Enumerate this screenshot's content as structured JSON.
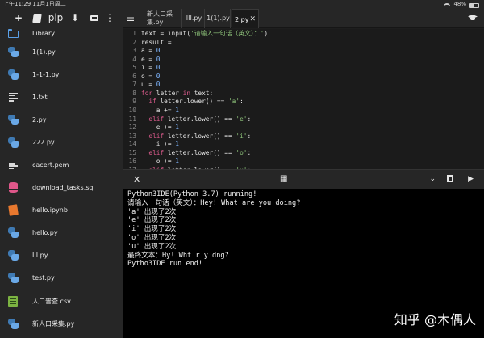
{
  "status_bar": {
    "time": "上午11:29",
    "date": "11月1日周二",
    "battery": "48%",
    "battery_level": 0.48
  },
  "sidebar": {
    "toolbar": {
      "add_label": "+",
      "pip_label": "pip",
      "download_label": "⬇",
      "more_label": "⋮"
    },
    "files": [
      {
        "name": "Library",
        "icon": "folder-icon"
      },
      {
        "name": "1(1).py",
        "icon": "python-file-icon"
      },
      {
        "name": "1-1-1.py",
        "icon": "python-file-icon"
      },
      {
        "name": "1.txt",
        "icon": "text-file-icon"
      },
      {
        "name": "2.py",
        "icon": "python-file-icon"
      },
      {
        "name": "222.py",
        "icon": "python-file-icon"
      },
      {
        "name": "cacert.pem",
        "icon": "text-file-icon"
      },
      {
        "name": "download_tasks.sql",
        "icon": "database-file-icon"
      },
      {
        "name": "hello.ipynb",
        "icon": "notebook-file-icon"
      },
      {
        "name": "hello.py",
        "icon": "python-file-icon"
      },
      {
        "name": "III.py",
        "icon": "python-file-icon"
      },
      {
        "name": "test.py",
        "icon": "python-file-icon"
      },
      {
        "name": "人口普查.csv",
        "icon": "csv-file-icon"
      },
      {
        "name": "新人口采集.py",
        "icon": "python-file-icon"
      }
    ]
  },
  "tabs": [
    {
      "label_line1": "新人口采",
      "label_line2": "集.py"
    },
    {
      "label": "III.py"
    },
    {
      "label": "1(1).py"
    },
    {
      "label": "2.py",
      "active": true,
      "close": "✕"
    }
  ],
  "code": {
    "lines": [
      {
        "n": "1",
        "parts": [
          [
            "tx",
            "text = "
          ],
          [
            "fn",
            "input"
          ],
          [
            "tx",
            "("
          ],
          [
            "str",
            "'请输入一句话（英文）：'"
          ],
          [
            "tx",
            ")"
          ]
        ]
      },
      {
        "n": "2",
        "parts": [
          [
            "tx",
            "result = "
          ],
          [
            "str",
            "''"
          ]
        ]
      },
      {
        "n": "3",
        "parts": [
          [
            "tx",
            "a = "
          ],
          [
            "num",
            "0"
          ]
        ]
      },
      {
        "n": "4",
        "parts": [
          [
            "tx",
            "e = "
          ],
          [
            "num",
            "0"
          ]
        ]
      },
      {
        "n": "5",
        "parts": [
          [
            "tx",
            "i = "
          ],
          [
            "num",
            "0"
          ]
        ]
      },
      {
        "n": "6",
        "parts": [
          [
            "tx",
            "o = "
          ],
          [
            "num",
            "0"
          ]
        ]
      },
      {
        "n": "7",
        "parts": [
          [
            "tx",
            "u = "
          ],
          [
            "num",
            "0"
          ]
        ]
      },
      {
        "n": "8",
        "parts": [
          [
            "kw",
            "for"
          ],
          [
            "tx",
            " letter "
          ],
          [
            "kw",
            "in"
          ],
          [
            "tx",
            " text:"
          ]
        ]
      },
      {
        "n": "9",
        "parts": [
          [
            "tx",
            "  "
          ],
          [
            "kw",
            "if"
          ],
          [
            "tx",
            " letter.lower() == "
          ],
          [
            "str",
            "'a'"
          ],
          [
            "tx",
            ":"
          ]
        ]
      },
      {
        "n": "10",
        "parts": [
          [
            "tx",
            "    a += "
          ],
          [
            "num",
            "1"
          ]
        ]
      },
      {
        "n": "11",
        "parts": [
          [
            "tx",
            "  "
          ],
          [
            "kw",
            "elif"
          ],
          [
            "tx",
            " letter.lower() == "
          ],
          [
            "str",
            "'e'"
          ],
          [
            "tx",
            ":"
          ]
        ]
      },
      {
        "n": "12",
        "parts": [
          [
            "tx",
            "    e += "
          ],
          [
            "num",
            "1"
          ]
        ]
      },
      {
        "n": "13",
        "parts": [
          [
            "tx",
            "  "
          ],
          [
            "kw",
            "elif"
          ],
          [
            "tx",
            " letter.lower() == "
          ],
          [
            "str",
            "'i'"
          ],
          [
            "tx",
            ":"
          ]
        ]
      },
      {
        "n": "14",
        "parts": [
          [
            "tx",
            "    i += "
          ],
          [
            "num",
            "1"
          ]
        ]
      },
      {
        "n": "15",
        "parts": [
          [
            "tx",
            "  "
          ],
          [
            "kw",
            "elif"
          ],
          [
            "tx",
            " letter.lower() == "
          ],
          [
            "str",
            "'o'"
          ],
          [
            "tx",
            ":"
          ]
        ]
      },
      {
        "n": "16",
        "parts": [
          [
            "tx",
            "    o += "
          ],
          [
            "num",
            "1"
          ]
        ]
      },
      {
        "n": "17",
        "parts": [
          [
            "tx",
            "  "
          ],
          [
            "kw",
            "elif"
          ],
          [
            "tx",
            " letter.lower() == "
          ],
          [
            "str",
            "'u'"
          ],
          [
            "tx",
            ":"
          ]
        ]
      }
    ]
  },
  "console": {
    "lines": [
      "Python3IDE(Python 3.7) running!",
      "请输入一句话（英文）：Hey! What are you doing?",
      "'a' 出现了2次",
      "'e' 出现了2次",
      "'i' 出现了2次",
      "'o' 出现了2次",
      "'u' 出现了2次",
      "最终文本：Hy! Wht r y dng?",
      "Pytho3IDE run end!"
    ]
  },
  "console_toolbar": {
    "close": "✕",
    "keyboard": "▦",
    "collapse": "⌄",
    "run": "▶"
  },
  "watermark": "知乎 @木偶人"
}
